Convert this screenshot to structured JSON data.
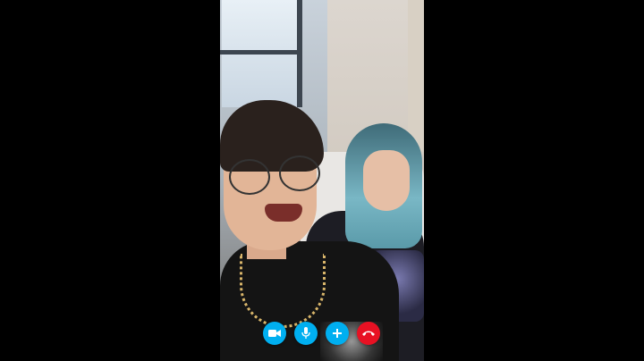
{
  "call": {
    "participants_visible": 2,
    "controls": [
      {
        "id": "video",
        "icon": "video-camera-icon",
        "color": "#00aff0"
      },
      {
        "id": "mic",
        "icon": "microphone-icon",
        "color": "#00aff0"
      },
      {
        "id": "add",
        "icon": "plus-icon",
        "color": "#00aff0"
      },
      {
        "id": "end",
        "icon": "hang-up-icon",
        "color": "#e81123"
      }
    ]
  }
}
